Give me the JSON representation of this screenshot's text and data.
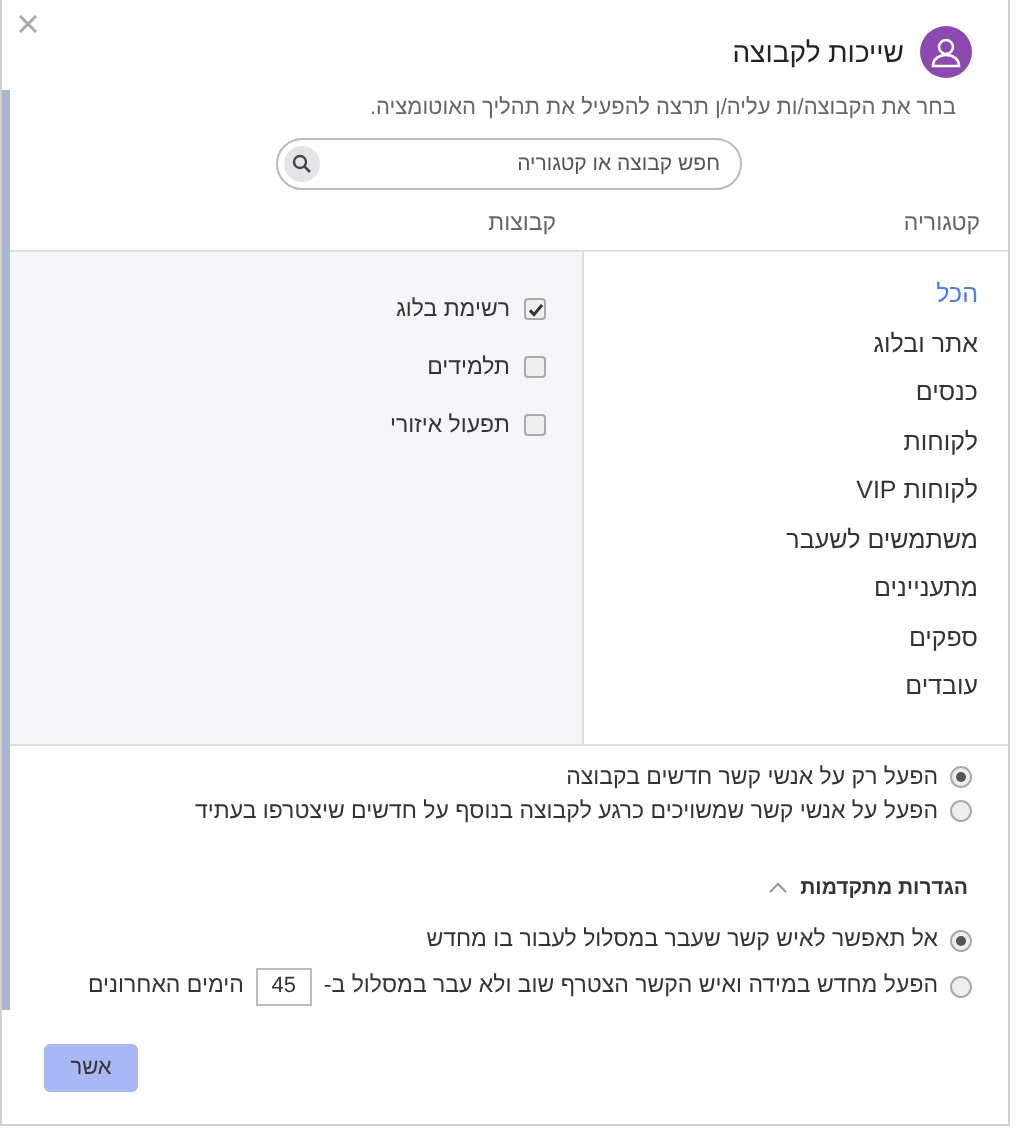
{
  "dialog": {
    "title": "שייכות לקבוצה",
    "subtitle": "בחר את הקבוצה/ות עליה/ן תרצה להפעיל את תהליך האוטומציה.",
    "search": {
      "placeholder": "חפש קבוצה או קטגוריה"
    },
    "columns": [
      "קטגוריה",
      "קבוצות"
    ],
    "categories": [
      {
        "label": "הכל",
        "selected": true
      },
      {
        "label": "אתר ובלוג",
        "selected": false
      },
      {
        "label": "כנסים",
        "selected": false
      },
      {
        "label": "לקוחות",
        "selected": false
      },
      {
        "label": "לקוחות VIP",
        "selected": false
      },
      {
        "label": "משתמשים לשעבר",
        "selected": false
      },
      {
        "label": "מתעניינים",
        "selected": false
      },
      {
        "label": "ספקים",
        "selected": false
      },
      {
        "label": "עובדים",
        "selected": false
      }
    ],
    "groups": [
      {
        "label": "רשימת בלוג",
        "checked": true
      },
      {
        "label": "תלמידים",
        "checked": false
      },
      {
        "label": "תפעול איזורי",
        "checked": false
      }
    ],
    "scope_options": [
      {
        "label": "הפעל רק על אנשי קשר חדשים בקבוצה",
        "selected": true
      },
      {
        "label": "הפעל על אנשי קשר שמשויכים כרגע לקבוצה בנוסף על חדשים שיצטרפו בעתיד",
        "selected": false
      }
    ],
    "advanced": {
      "title": "הגדרות מתקדמות",
      "expanded": true,
      "options": [
        {
          "kind": "text",
          "label": "אל תאפשר לאיש קשר שעבר במסלול לעבור בו מחדש",
          "selected": true
        },
        {
          "kind": "days",
          "label": "הפעל מחדש במידה ואיש הקשר הצטרף שוב ולא עבר במסלול ב-",
          "value": "45",
          "suffix": "הימים האחרונים",
          "selected": false
        }
      ]
    },
    "buttons": [
      {
        "label": "אשר"
      }
    ]
  }
}
